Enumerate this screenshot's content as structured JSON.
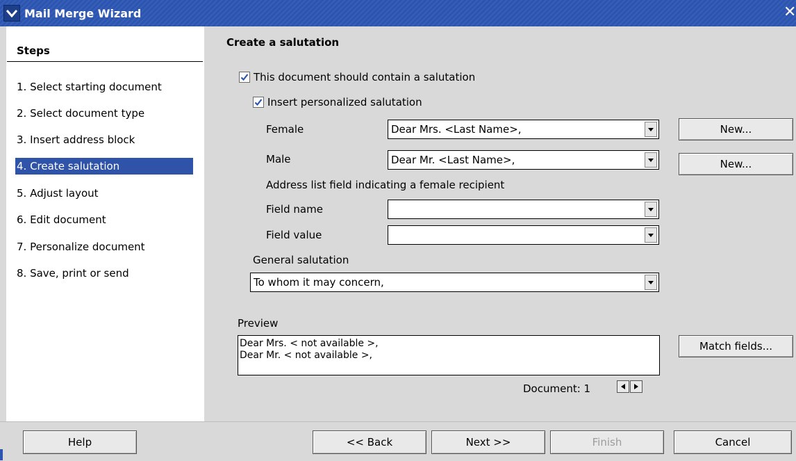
{
  "window": {
    "title": "Mail Merge Wizard",
    "icons": {
      "menu": "chevron-down-icon",
      "close": "close-icon"
    }
  },
  "sidebar": {
    "title": "Steps",
    "steps": [
      {
        "label": "1. Select starting document"
      },
      {
        "label": "2. Select document type"
      },
      {
        "label": "3. Insert address block"
      },
      {
        "label": "4. Create salutation",
        "active": true
      },
      {
        "label": "5. Adjust layout"
      },
      {
        "label": "6. Edit document"
      },
      {
        "label": "7. Personalize document"
      },
      {
        "label": "8. Save, print or send"
      }
    ]
  },
  "main": {
    "heading": "Create a salutation",
    "contain_salutation": {
      "label": "This document should contain a salutation",
      "checked": true
    },
    "personalized": {
      "label": "Insert personalized salutation",
      "checked": true
    },
    "female": {
      "label": "Female",
      "value": "Dear Mrs. <Last Name>,",
      "new_button": "New..."
    },
    "male": {
      "label": "Male",
      "value": "Dear Mr. <Last Name>,",
      "new_button": "New..."
    },
    "address_field_caption": "Address list field indicating a female recipient",
    "field_name": {
      "label": "Field name",
      "value": ""
    },
    "field_value": {
      "label": "Field value",
      "value": ""
    },
    "general": {
      "label": "General salutation",
      "value": "To whom it may concern,"
    },
    "preview": {
      "label": "Preview",
      "lines": [
        "Dear Mrs. < not available >,",
        "Dear Mr. < not available >,"
      ],
      "match_button": "Match fields..."
    },
    "document_nav": {
      "label": "Document: 1"
    }
  },
  "footer": {
    "help": "Help",
    "back": "<< Back",
    "next": "Next >>",
    "finish": "Finish",
    "cancel": "Cancel"
  },
  "colors": {
    "titlebar": "#2b55b0",
    "selection": "#2f53a8",
    "panel": "#d9d9d9",
    "disabled_text": "#9c9c9c"
  }
}
